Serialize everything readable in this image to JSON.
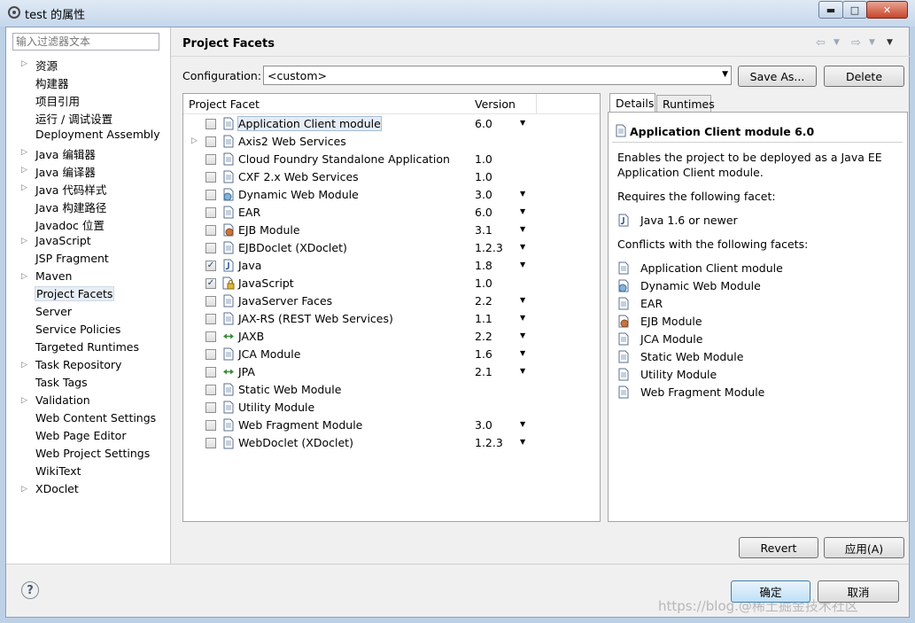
{
  "window": {
    "title": "test 的属性",
    "min_glyph": "▬",
    "max_glyph": "□",
    "close_glyph": "✕"
  },
  "sidebar": {
    "filter_placeholder": "输入过滤器文本",
    "items": [
      {
        "label": "资源",
        "expandable": true
      },
      {
        "label": "构建器",
        "expandable": false
      },
      {
        "label": "项目引用",
        "expandable": false
      },
      {
        "label": "运行 / 调试设置",
        "expandable": false
      },
      {
        "label": "Deployment Assembly",
        "expandable": false
      },
      {
        "label": "Java 编辑器",
        "expandable": true
      },
      {
        "label": "Java 编译器",
        "expandable": true
      },
      {
        "label": "Java 代码样式",
        "expandable": true
      },
      {
        "label": "Java 构建路径",
        "expandable": false
      },
      {
        "label": "Javadoc 位置",
        "expandable": false
      },
      {
        "label": "JavaScript",
        "expandable": true
      },
      {
        "label": "JSP Fragment",
        "expandable": false
      },
      {
        "label": "Maven",
        "expandable": true
      },
      {
        "label": "Project Facets",
        "expandable": false,
        "selected": true
      },
      {
        "label": "Server",
        "expandable": false
      },
      {
        "label": "Service Policies",
        "expandable": false
      },
      {
        "label": "Targeted Runtimes",
        "expandable": false
      },
      {
        "label": "Task Repository",
        "expandable": true
      },
      {
        "label": "Task Tags",
        "expandable": false
      },
      {
        "label": "Validation",
        "expandable": true
      },
      {
        "label": "Web Content Settings",
        "expandable": false
      },
      {
        "label": "Web Page Editor",
        "expandable": false
      },
      {
        "label": "Web Project Settings",
        "expandable": false
      },
      {
        "label": "WikiText",
        "expandable": false
      },
      {
        "label": "XDoclet",
        "expandable": true
      }
    ]
  },
  "page": {
    "title": "Project Facets",
    "config_label": "Configuration:",
    "config_value": "<custom>",
    "save_as_label": "Save As...",
    "delete_label": "Delete",
    "revert_label": "Revert",
    "apply_label": "应用(A)"
  },
  "facets_table": {
    "col_facet": "Project Facet",
    "col_version": "Version",
    "rows": [
      {
        "name": "Application Client module",
        "version": "6.0",
        "checked": false,
        "dropdown": true,
        "selected": true,
        "expandable": false,
        "icon": "doc-icon"
      },
      {
        "name": "Axis2 Web Services",
        "version": "",
        "checked": false,
        "dropdown": false,
        "expandable": true,
        "icon": "doc-icon"
      },
      {
        "name": "Cloud Foundry Standalone Application",
        "version": "1.0",
        "checked": false,
        "dropdown": false,
        "expandable": false,
        "icon": "doc-icon"
      },
      {
        "name": "CXF 2.x Web Services",
        "version": "1.0",
        "checked": false,
        "dropdown": false,
        "expandable": false,
        "icon": "doc-icon"
      },
      {
        "name": "Dynamic Web Module",
        "version": "3.0",
        "checked": false,
        "dropdown": true,
        "expandable": false,
        "icon": "globe-icon"
      },
      {
        "name": "EAR",
        "version": "6.0",
        "checked": false,
        "dropdown": true,
        "expandable": false,
        "icon": "doc-icon"
      },
      {
        "name": "EJB Module",
        "version": "3.1",
        "checked": false,
        "dropdown": true,
        "expandable": false,
        "icon": "bean-icon"
      },
      {
        "name": "EJBDoclet (XDoclet)",
        "version": "1.2.3",
        "checked": false,
        "dropdown": true,
        "expandable": false,
        "icon": "doc-icon"
      },
      {
        "name": "Java",
        "version": "1.8",
        "checked": true,
        "dropdown": true,
        "expandable": false,
        "icon": "java-icon"
      },
      {
        "name": "JavaScript",
        "version": "1.0",
        "checked": true,
        "dropdown": false,
        "expandable": false,
        "icon": "lock-doc-icon"
      },
      {
        "name": "JavaServer Faces",
        "version": "2.2",
        "checked": false,
        "dropdown": true,
        "expandable": false,
        "icon": "doc-icon"
      },
      {
        "name": "JAX-RS (REST Web Services)",
        "version": "1.1",
        "checked": false,
        "dropdown": true,
        "expandable": false,
        "icon": "doc-icon"
      },
      {
        "name": "JAXB",
        "version": "2.2",
        "checked": false,
        "dropdown": true,
        "expandable": false,
        "icon": "arrows-icon"
      },
      {
        "name": "JCA Module",
        "version": "1.6",
        "checked": false,
        "dropdown": true,
        "expandable": false,
        "icon": "doc-icon"
      },
      {
        "name": "JPA",
        "version": "2.1",
        "checked": false,
        "dropdown": true,
        "expandable": false,
        "icon": "arrows-icon"
      },
      {
        "name": "Static Web Module",
        "version": "",
        "checked": false,
        "dropdown": false,
        "expandable": false,
        "icon": "doc-icon"
      },
      {
        "name": "Utility Module",
        "version": "",
        "checked": false,
        "dropdown": false,
        "expandable": false,
        "icon": "doc-icon"
      },
      {
        "name": "Web Fragment Module",
        "version": "3.0",
        "checked": false,
        "dropdown": true,
        "expandable": false,
        "icon": "doc-icon"
      },
      {
        "name": "WebDoclet (XDoclet)",
        "version": "1.2.3",
        "checked": false,
        "dropdown": true,
        "expandable": false,
        "icon": "doc-icon"
      }
    ]
  },
  "details": {
    "tab_details": "Details",
    "tab_runtimes": "Runtimes",
    "title": "Application Client module 6.0",
    "desc_line1": "Enables the project to be deployed as a Java EE",
    "desc_line2": "Application Client module.",
    "requires_label": "Requires the following facet:",
    "requires": [
      {
        "label": "Java 1.6 or newer",
        "icon": "java-icon"
      }
    ],
    "conflicts_label": "Conflicts with the following facets:",
    "conflicts": [
      {
        "label": "Application Client module",
        "icon": "doc-icon"
      },
      {
        "label": "Dynamic Web Module",
        "icon": "globe-icon"
      },
      {
        "label": "EAR",
        "icon": "doc-icon"
      },
      {
        "label": "EJB Module",
        "icon": "bean-icon"
      },
      {
        "label": "JCA Module",
        "icon": "doc-icon"
      },
      {
        "label": "Static Web Module",
        "icon": "doc-icon"
      },
      {
        "label": "Utility Module",
        "icon": "doc-icon"
      },
      {
        "label": "Web Fragment Module",
        "icon": "doc-icon"
      }
    ]
  },
  "footer": {
    "help_glyph": "?",
    "ok_label": "确定",
    "cancel_label": "取消",
    "watermark": "https://blog.@稀土掘金技术社区"
  },
  "colors": {
    "accent": "#3c7fb1",
    "selection_bg": "#e5edf7"
  }
}
